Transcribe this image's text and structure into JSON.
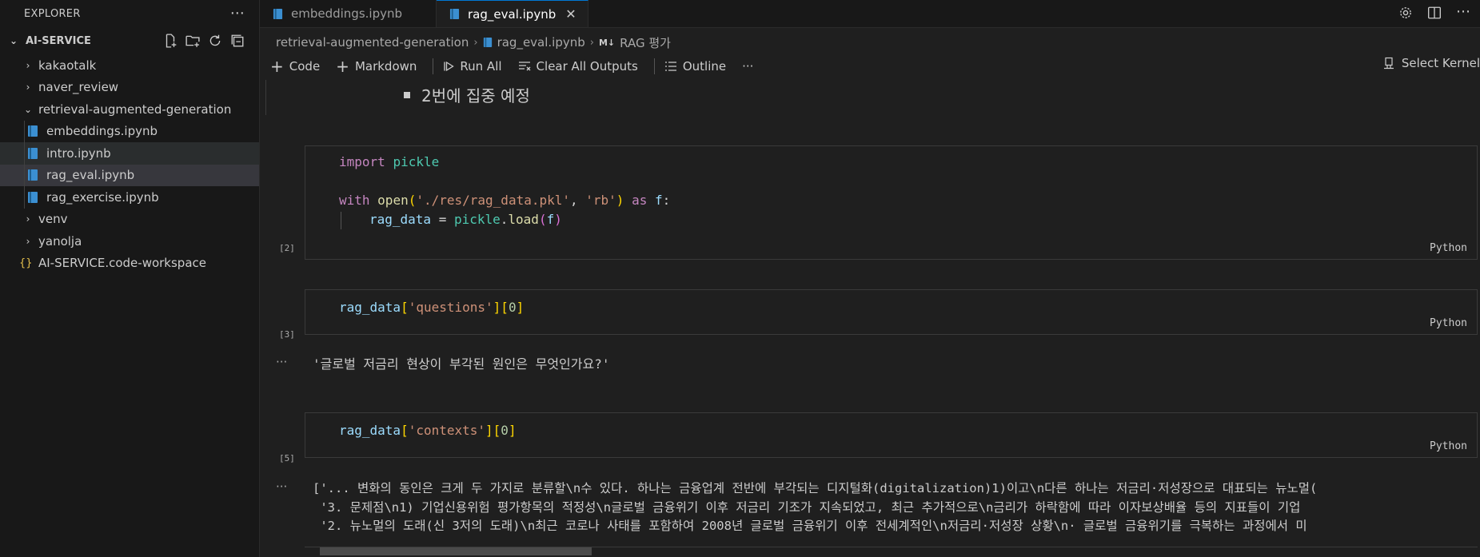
{
  "explorer": {
    "title": "EXPLORER",
    "workspace": "AI-SERVICE",
    "items": [
      {
        "label": "kakaotalk",
        "type": "folder",
        "level": 1
      },
      {
        "label": "naver_review",
        "type": "folder",
        "level": 1
      },
      {
        "label": "retrieval-augmented-generation",
        "type": "folder-open",
        "level": 1
      },
      {
        "label": "embeddings.ipynb",
        "type": "notebook",
        "level": 2
      },
      {
        "label": "intro.ipynb",
        "type": "notebook",
        "level": 2
      },
      {
        "label": "rag_eval.ipynb",
        "type": "notebook",
        "level": 2
      },
      {
        "label": "rag_exercise.ipynb",
        "type": "notebook",
        "level": 2
      },
      {
        "label": "venv",
        "type": "folder",
        "level": 1
      },
      {
        "label": "yanolja",
        "type": "folder",
        "level": 1
      },
      {
        "label": "AI-SERVICE.code-workspace",
        "type": "workspace",
        "level": 1
      }
    ]
  },
  "tabs": [
    {
      "label": "embeddings.ipynb"
    },
    {
      "label": "rag_eval.ipynb"
    }
  ],
  "breadcrumb": {
    "folder": "retrieval-augmented-generation",
    "file": "rag_eval.ipynb",
    "md_badge": "M↓",
    "section": "RAG 평가"
  },
  "toolbar": {
    "code": "Code",
    "markdown": "Markdown",
    "run_all": "Run All",
    "clear": "Clear All Outputs",
    "outline": "Outline",
    "more": "···",
    "kernel": "Select Kernel"
  },
  "notebook": {
    "markdown_line": "2번에 집중 예정",
    "cells": [
      {
        "exec": "[2]",
        "lang": "Python"
      },
      {
        "exec": "[3]",
        "lang": "Python"
      },
      {
        "exec": "[5]",
        "lang": "Python"
      }
    ],
    "code": {
      "c1_l1_kw": "import",
      "c1_l1_mod": "pickle",
      "c1_l3_kw": "with",
      "c1_l3_fn": "open",
      "c1_l3_p1": "(",
      "c1_l3_s1": "'./res/rag_data.pkl'",
      "c1_l3_comma": ", ",
      "c1_l3_s2": "'rb'",
      "c1_l3_p2": ")",
      "c1_l3_as": "as",
      "c1_l3_f": "f",
      "c1_l3_colon": ":",
      "c1_l4_var": "rag_data",
      "c1_l4_eq": " = ",
      "c1_l4_mod": "pickle",
      "c1_l4_dot": ".",
      "c1_l4_fn": "load",
      "c1_l4_p1": "(",
      "c1_l4_f": "f",
      "c1_l4_p2": ")",
      "c2_var": "rag_data",
      "c2_b1": "[",
      "c2_s": "'questions'",
      "c2_b2": "][",
      "c2_n": "0",
      "c2_b3": "]",
      "c3_var": "rag_data",
      "c3_b1": "[",
      "c3_s": "'contexts'",
      "c3_b2": "][",
      "c3_n": "0",
      "c3_b3": "]"
    },
    "outputs": {
      "dots": "···",
      "o2": "'글로벌 저금리 현상이 부각된 원인은 무엇인가요?'",
      "o3_l1": "['... 변화의 동인은 크게 두 가지로 분류할\\n수 있다. 하나는 금융업계 전반에 부각되는 디지털화(digitalization)1)이고\\n다른 하나는 저금리·저성장으로 대표되는 뉴노멀(",
      "o3_l2": " '3. 문제점\\n1) 기업신용위험 평가항목의 적정성\\n글로벌 금융위기 이후 저금리 기조가 지속되었고, 최근 추가적으로\\n금리가 하락함에 따라 이자보상배율 등의 지표들이 기업",
      "o3_l3": " '2. 뉴노멀의 도래(신 3저의 도래)\\n최근 코로나 사태를 포함하여 2008년 글로벌 금융위기 이후 전세계적인\\n저금리·저성장 상황\\n· 글로벌 금융위기를 극복하는 과정에서 미"
    }
  }
}
